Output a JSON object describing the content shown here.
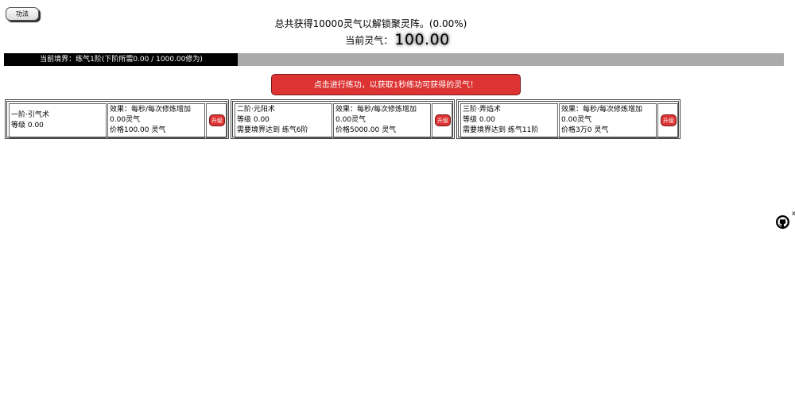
{
  "tab_button": "功法",
  "goal_text": "总共获得10000灵气以解锁聚灵阵。(0.00%)",
  "qi": {
    "label": "当前灵气：",
    "value": "100.00"
  },
  "realm": {
    "text": "当前境界：练气1阶(下阶所需0.00 / 1000.00修为)",
    "progress_fraction": 0.3
  },
  "cultivate_button": "点击进行练功，以获取1秒练功可获得的灵气！",
  "skills": [
    {
      "name": "一阶·引气术",
      "level": "等级 0.00",
      "requirement": "",
      "effect_line1": "效果：每秒/每次修炼增加",
      "effect_line2": "0.00灵气",
      "price": "价格100.00 灵气",
      "upgrade": "升级"
    },
    {
      "name": "二阶·元阳术",
      "level": "等级 0.00",
      "requirement": "需要境界达到 练气6阶",
      "effect_line1": "效果：每秒/每次修炼增加",
      "effect_line2": "0.00灵气",
      "price": "价格5000.00 灵气",
      "upgrade": "升级"
    },
    {
      "name": "三阶·弄焰术",
      "level": "等级 0.00",
      "requirement": "需要境界达到 练气11阶",
      "effect_line1": "效果：每秒/每次修炼增加",
      "effect_line2": "0.00灵气",
      "price": "价格3万0 灵气",
      "upgrade": "升级"
    }
  ],
  "side_close": "x",
  "icons": {
    "github": "github-icon"
  }
}
